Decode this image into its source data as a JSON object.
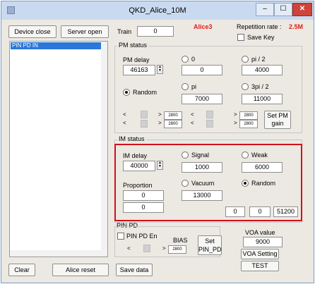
{
  "window": {
    "title": "QKD_Alice_10M",
    "close_glyph": "✕",
    "min_glyph": "–",
    "max_glyph": "☐"
  },
  "left": {
    "device_close": "Device close",
    "server_open": "Server open",
    "list_items": [
      "PIN PD IN"
    ],
    "clear": "Clear",
    "alice_reset": "Alice reset"
  },
  "header": {
    "train_label": "Train",
    "train_value": "0",
    "alice_tag": "Alice3",
    "rep_rate_label": "Repetition rate :",
    "rep_rate_value": "2.5M",
    "save_key": "Save Key",
    "accent_color": "#e0201b"
  },
  "pm": {
    "title": "PM status",
    "delay_label": "PM delay",
    "delay_value": "46163",
    "random_label": "Random",
    "opt_0": "0",
    "opt_0_value": "0",
    "opt_pi2": "pi / 2",
    "opt_pi2_value": "4000",
    "opt_pi": "pi",
    "opt_pi_value": "7000",
    "opt_3pi2": "3pi / 2",
    "opt_3pi2_value": "11000",
    "slider_a_top": "2800",
    "slider_a_bottom": "2800",
    "slider_b_top": "2800",
    "slider_b_bottom": "2800",
    "set_gain": "Set PM gain"
  },
  "im": {
    "title": "IM status",
    "delay_label": "IM delay",
    "delay_value": "40000",
    "signal_label": "Signal",
    "signal_value": "1000",
    "weak_label": "Weak",
    "weak_value": "6000",
    "proportion_label": "Proportion",
    "proportion_value_1": "0",
    "proportion_value_2": "0",
    "vacuum_label": "Vacuum",
    "vacuum_value": "13000",
    "random_label": "Random",
    "out_1": "0",
    "out_2": "0",
    "out_3": "51200"
  },
  "pin": {
    "title": "PIN PD",
    "enable_label": "PIN PD En",
    "bias_label": "BIAS",
    "bias_value": "2800",
    "set_pin": "Set PIN_PD"
  },
  "voa": {
    "label": "VOA value",
    "value": "9000",
    "setting": "VOA Setting",
    "test": "TEST"
  },
  "bottom": {
    "save_data": "Save data"
  }
}
